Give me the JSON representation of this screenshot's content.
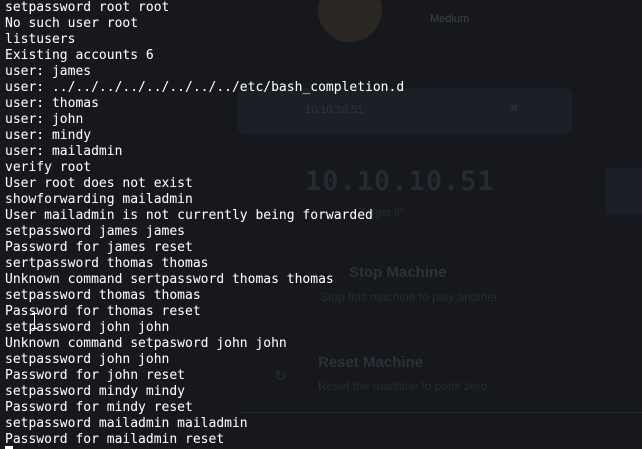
{
  "background_page": {
    "difficulty": "Medium",
    "input_placeholder": "10.10.10.51",
    "input_icon": "wrench-icon",
    "ip": "10.10.10.51",
    "ip_label": "Target IP",
    "stop_title": "Stop Machine",
    "stop_desc": "Stop this machine to play another",
    "reset_title": "Reset Machine",
    "reset_desc": "Reset the machine to point zero"
  },
  "terminal": {
    "lines": [
      "setpassword root root",
      "No such user root",
      "listusers",
      "Existing accounts 6",
      "user: james",
      "user: ../../../../../../../../etc/bash_completion.d",
      "user: thomas",
      "user: john",
      "user: mindy",
      "user: mailadmin",
      "verify root",
      "User root does not exist",
      "showforwarding mailadmin",
      "User mailadmin is not currently being forwarded",
      "setpassword james james",
      "Password for james reset",
      "sertpassword thomas thomas",
      "Unknown command sertpassword thomas thomas",
      "setpassword thomas thomas",
      "Password for thomas reset",
      "setpassword john john",
      "Unknown command setpasword john john",
      "setpassword john john",
      "Password for john reset",
      "setpassword mindy mindy",
      "Password for mindy reset",
      "setpassword mailadmin mailadmin",
      "Password for mailadmin reset"
    ]
  }
}
